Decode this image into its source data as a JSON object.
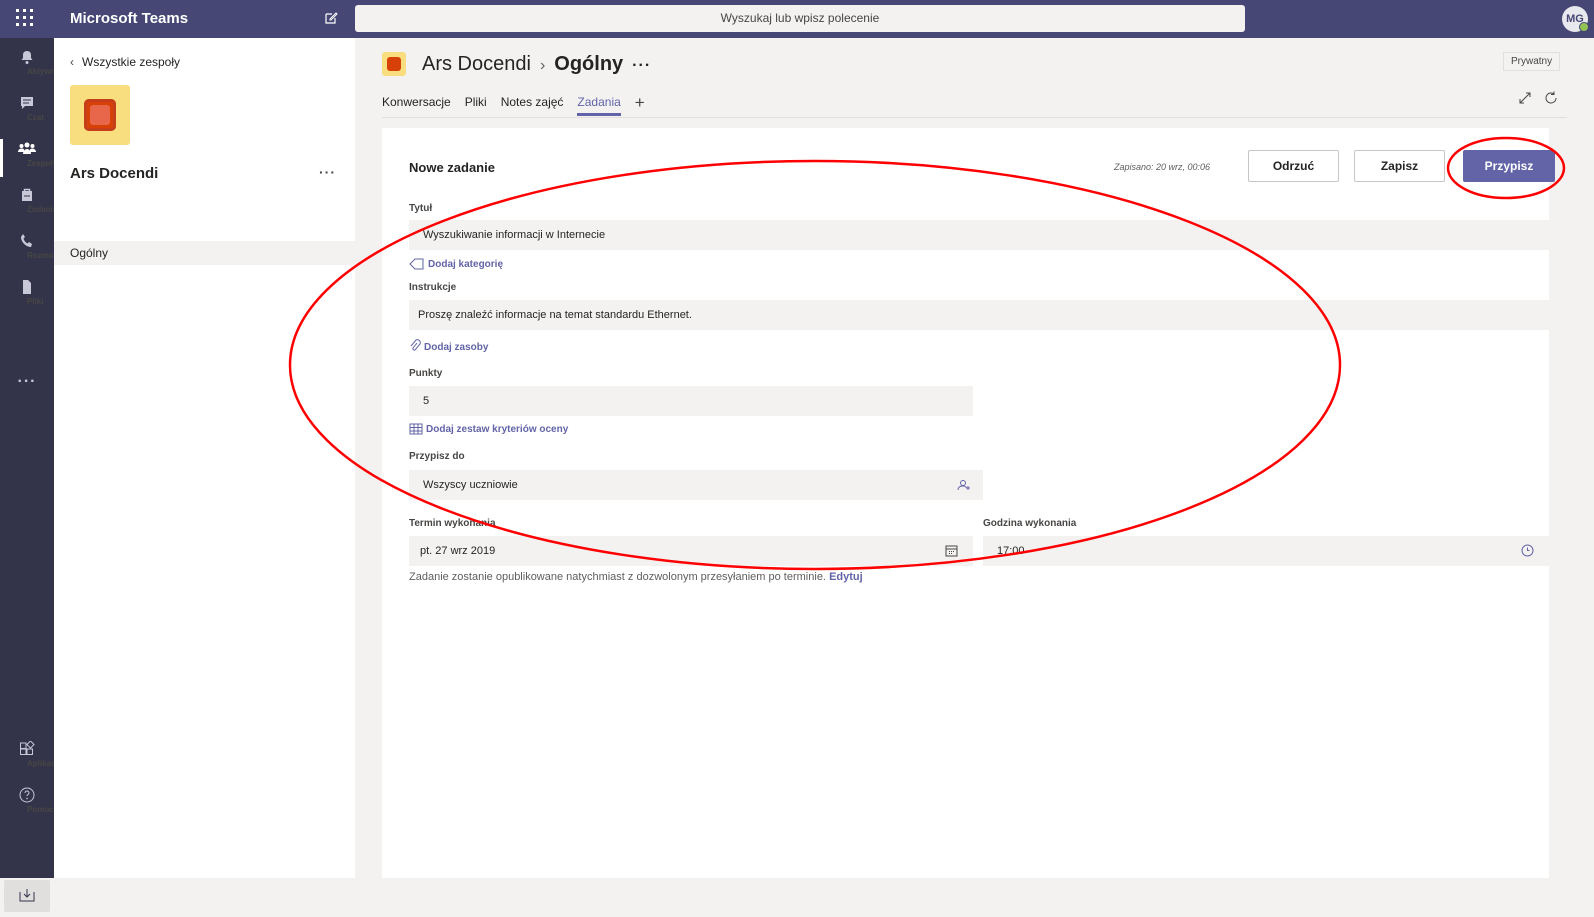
{
  "app": {
    "title": "Microsoft Teams",
    "search_placeholder": "Wyszukaj lub wpisz polecenie",
    "avatar_initials": "MG"
  },
  "rail": {
    "items": [
      {
        "label": "Aktywność",
        "icon": "bell-icon"
      },
      {
        "label": "Czat",
        "icon": "chat-icon"
      },
      {
        "label": "Zespoły",
        "icon": "teams-icon",
        "active": true
      },
      {
        "label": "Zadania",
        "icon": "assignments-icon"
      },
      {
        "label": "Rozmowy",
        "icon": "phone-icon"
      },
      {
        "label": "Pliki",
        "icon": "file-icon"
      }
    ],
    "more": "···",
    "apps_label": "Aplikacje",
    "help_label": "Pomoc"
  },
  "panel": {
    "back_label": "Wszystkie zespoły",
    "team_name": "Ars Docendi",
    "more": "···",
    "channel": "Ogólny"
  },
  "header": {
    "team": "Ars Docendi",
    "channel": "Ogólny",
    "dots": "···",
    "privacy": "Prywatny",
    "tabs": [
      "Konwersacje",
      "Pliki",
      "Notes zajęć",
      "Zadania"
    ],
    "active_tab": "Zadania",
    "add_tab": "+"
  },
  "form": {
    "title": "Nowe zadanie",
    "saved": "Zapisano: 20 wrz, 00:06",
    "discard": "Odrzuć",
    "save": "Zapisz",
    "assign": "Przypisz",
    "title_label": "Tytuł",
    "title_value": "Wyszukiwanie informacji w Internecie",
    "add_category": "Dodaj kategorię",
    "instructions_label": "Instrukcje",
    "instructions_value": "Proszę znaleźć informacje na temat standardu Ethernet.",
    "add_resources": "Dodaj zasoby",
    "points_label": "Punkty",
    "points_value": "5",
    "add_rubric": "Dodaj zestaw kryteriów oceny",
    "assign_to_label": "Przypisz do",
    "assign_to_value": "Wszyscy uczniowie",
    "due_date_label": "Termin wykonania",
    "due_date_value": "pt. 27 wrz 2019",
    "due_time_label": "Godzina wykonania",
    "due_time_value": "17:00",
    "note": "Zadanie zostanie opublikowane natychmiast z dozwolonym przesyłaniem po terminie.",
    "edit_link": "Edytuj"
  },
  "colors": {
    "accent": "#6264a7",
    "topbar": "#464775",
    "rail": "#33344a",
    "annotation": "#ff0000"
  }
}
